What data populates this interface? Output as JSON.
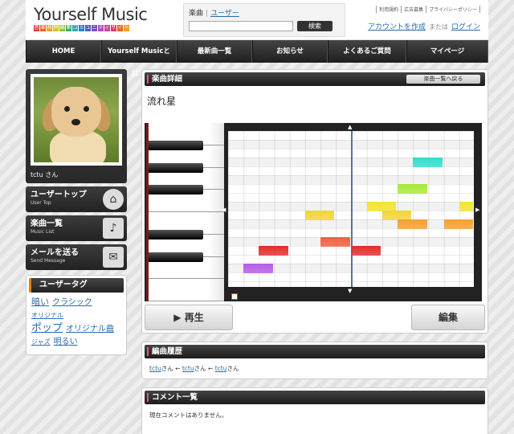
{
  "header": {
    "logo_title": "Yourself Music",
    "logo_sub_chars": [
      "音",
      "楽",
      "共",
      "同",
      "編",
      "集",
      "コ",
      "ミ",
      "ュ",
      "ニ",
      "テ",
      "ィ",
      "サ",
      "イ",
      "ト"
    ],
    "logo_sub_colors": [
      "#e13b3b",
      "#e8622a",
      "#f0a020",
      "#d9c21c",
      "#8cc03c",
      "#3aa85c",
      "#2fa7b5",
      "#2b7fcb",
      "#4a5cc7",
      "#7a4ec2",
      "#b04bb8",
      "#d6468e",
      "#e13b6a",
      "#e8622a",
      "#f0a020"
    ],
    "search": {
      "tab_active": "楽曲",
      "tab_link": "ユーザー",
      "button": "検索"
    },
    "top_links": [
      "利用規約",
      "広告募集",
      "プライバシーポリシー"
    ],
    "account": {
      "create": "アカウントを作成",
      "or": "または",
      "login": "ログイン"
    }
  },
  "nav": [
    "HOME",
    "Yourself Musicとは？",
    "最新曲一覧",
    "お知らせ",
    "よくあるご質問",
    "マイページ"
  ],
  "sidebar": {
    "profile_name": "tctu さん",
    "buttons": [
      {
        "label": "ユーザートップ",
        "sub": "User Top",
        "icon": "⌂"
      },
      {
        "label": "楽曲一覧",
        "sub": "Music List",
        "icon": "♪"
      },
      {
        "label": "メールを送る",
        "sub": "Send Message",
        "icon": "✉"
      }
    ],
    "tags_title": "ユーザータグ",
    "tags": [
      "暗い",
      "クラシック",
      "オリジナル",
      "ポップ",
      "オリジナル曲",
      "ジャズ",
      "明るい"
    ]
  },
  "detail": {
    "title": "楽曲詳細",
    "back_button": "楽曲一覧へ戻る",
    "song_title": "流れ星",
    "play_button": "▶ 再生",
    "edit_button": "編集"
  },
  "history": {
    "title": "編曲履歴",
    "chain": [
      "tctu",
      "tctu",
      "tctu"
    ],
    "suffix": "さん",
    "arrow": "←"
  },
  "comments": {
    "title": "コメント一覧",
    "empty_text": "現在コメントはありません。"
  },
  "notes": [
    {
      "color": "#b65ce6",
      "step": 1,
      "row": 15,
      "len": 2
    },
    {
      "color": "#e42a2a",
      "step": 2,
      "row": 13,
      "len": 2
    },
    {
      "color": "#f06040",
      "step": 6,
      "row": 12,
      "len": 2
    },
    {
      "color": "#e42a2a",
      "step": 8,
      "row": 13,
      "len": 2
    },
    {
      "color": "#f2d438",
      "step": 5,
      "row": 9,
      "len": 2
    },
    {
      "color": "#f2e430",
      "step": 9,
      "row": 8,
      "len": 2
    },
    {
      "color": "#f2d438",
      "step": 10,
      "row": 9,
      "len": 2
    },
    {
      "color": "#f4a030",
      "step": 11,
      "row": 10,
      "len": 2
    },
    {
      "color": "#a8e838",
      "step": 11,
      "row": 6,
      "len": 2
    },
    {
      "color": "#2ee0cf",
      "step": 12,
      "row": 3,
      "len": 2
    },
    {
      "color": "#f4a030",
      "step": 14,
      "row": 10,
      "len": 2
    },
    {
      "color": "#f2e430",
      "step": 15,
      "row": 8,
      "len": 1
    }
  ]
}
